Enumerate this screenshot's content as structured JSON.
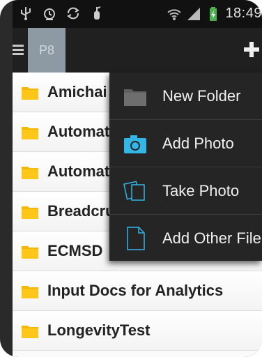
{
  "status_bar": {
    "time": "18:49"
  },
  "action_bar": {
    "title": "P8"
  },
  "files": [
    {
      "name": "Amichai"
    },
    {
      "name": "Automat"
    },
    {
      "name": "Automat"
    },
    {
      "name": "Breadcru"
    },
    {
      "name": "ECMSD"
    },
    {
      "name": "Input Docs for Analytics"
    },
    {
      "name": "LongevityTest"
    }
  ],
  "menu": {
    "items": [
      {
        "label": "New Folder",
        "icon": "folder-icon"
      },
      {
        "label": "Add Photo",
        "icon": "camera-icon"
      },
      {
        "label": "Take Photo",
        "icon": "photos-icon"
      },
      {
        "label": "Add Other File",
        "icon": "file-icon"
      }
    ]
  },
  "colors": {
    "accent": "#33b5e5",
    "folder": "#f5b800",
    "menu_bg": "#252525",
    "action_bar_bg": "#202020"
  }
}
